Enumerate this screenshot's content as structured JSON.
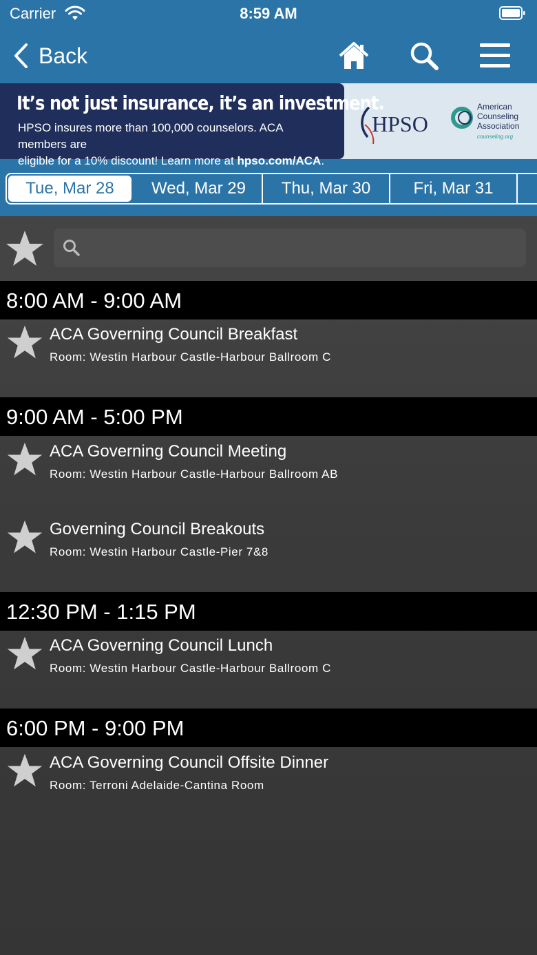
{
  "status_bar": {
    "carrier": "Carrier",
    "time": "8:59 AM"
  },
  "nav": {
    "back_label": "Back",
    "icons": [
      "home-icon",
      "search-icon",
      "menu-icon"
    ]
  },
  "ad": {
    "headline": "It’s not just insurance, it’s an investment.",
    "body_line1": "HPSO insures more than 100,000 counselors. ACA members are",
    "body_line2_prefix": "eligible for a 10% discount! Learn more at ",
    "body_link": "hpso.com/ACA",
    "body_line2_suffix": ".",
    "hpso_logo": "HPSO",
    "aca_line1": "American",
    "aca_line2": "Counseling",
    "aca_line3": "Association",
    "aca_url": "counseling.org"
  },
  "tabs": [
    {
      "label": "Tue, Mar 28",
      "active": true
    },
    {
      "label": "Wed, Mar 29",
      "active": false
    },
    {
      "label": "Thu, Mar 30",
      "active": false
    },
    {
      "label": "Fri, Mar 31",
      "active": false
    }
  ],
  "search": {
    "placeholder": ""
  },
  "schedule": [
    {
      "time": "8:00 AM - 9:00 AM",
      "sessions": [
        {
          "title": "ACA Governing Council Breakfast",
          "room": "Room: Westin Harbour Castle-Harbour Ballroom C"
        }
      ]
    },
    {
      "time": "9:00 AM - 5:00 PM",
      "sessions": [
        {
          "title": "ACA Governing Council Meeting",
          "room": "Room: Westin Harbour Castle-Harbour Ballroom AB"
        },
        {
          "title": "Governing Council Breakouts",
          "room": "Room: Westin Harbour Castle-Pier 7&8"
        }
      ]
    },
    {
      "time": "12:30 PM - 1:15 PM",
      "sessions": [
        {
          "title": "ACA Governing Council Lunch",
          "room": "Room: Westin Harbour Castle-Harbour Ballroom C"
        }
      ]
    },
    {
      "time": "6:00 PM - 9:00 PM",
      "sessions": [
        {
          "title": "ACA Governing Council Offsite Dinner",
          "room": "Room: Terroni Adelaide-Cantina Room"
        }
      ]
    }
  ],
  "colors": {
    "header_blue": "#2b74a8",
    "ad_navy": "#1f2e5a",
    "star_gray": "#cfcfcf"
  }
}
